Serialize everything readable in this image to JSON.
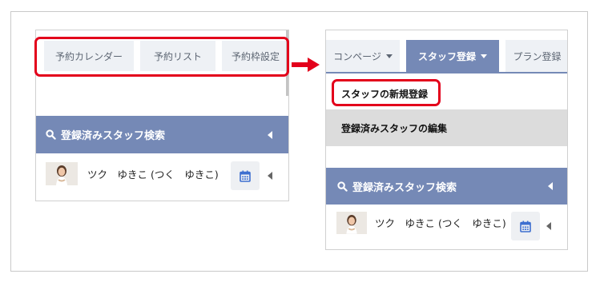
{
  "left_view": {
    "tabs": [
      {
        "label": "予約カレンダー"
      },
      {
        "label": "予約リスト"
      },
      {
        "label": "予約枠設定"
      }
    ],
    "search_title": "登録済みスタッフ検索",
    "staff": {
      "name": "ツク　ゆきこ (つく　ゆきこ)"
    }
  },
  "right_view": {
    "tabs": [
      {
        "label": "コンページ"
      },
      {
        "label": "スタッフ登録"
      },
      {
        "label": "プラン登録"
      }
    ],
    "menu": {
      "new_label": "スタッフの新規登録",
      "edit_label": "登録済みスタッフの編集"
    },
    "search_title": "登録済みスタッフ検索",
    "staff": {
      "name": "ツク　ゆきこ (つく　ゆきこ)"
    }
  },
  "colors": {
    "highlight": "#e3001b",
    "search_bar": "#7589b6",
    "active_tab": "#7589b6",
    "calendar_icon": "#3d6fd0"
  }
}
